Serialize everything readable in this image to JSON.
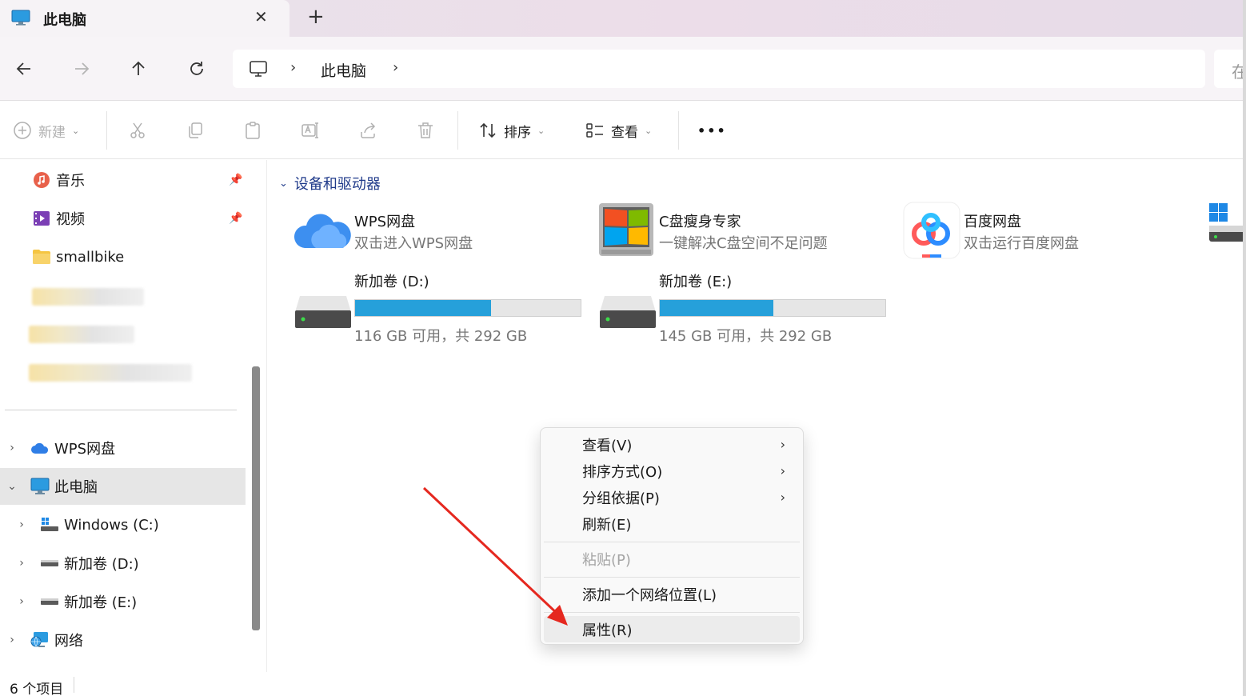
{
  "window": {
    "tab_title": "此电脑",
    "tab_close": "✕",
    "new_tab": "+"
  },
  "nav": {
    "address_segment": "此电脑",
    "sep": "›",
    "search_placeholder": "在"
  },
  "toolbar": {
    "new_label": "新建",
    "sort_label": "排序",
    "view_label": "查看",
    "more_label": "•••"
  },
  "sidebar": {
    "quick_items": [
      {
        "label": "音乐",
        "pinned": true
      },
      {
        "label": "视频",
        "pinned": true
      },
      {
        "label": "smallbike",
        "pinned": false
      }
    ],
    "tree": [
      {
        "label": "WPS网盘",
        "expanded": false
      },
      {
        "label": "此电脑",
        "expanded": true,
        "selected": true
      },
      {
        "label": "Windows (C:)",
        "expanded": false
      },
      {
        "label": "新加卷 (D:)",
        "expanded": false
      },
      {
        "label": "新加卷 (E:)",
        "expanded": false
      },
      {
        "label": "网络",
        "expanded": false
      }
    ]
  },
  "main": {
    "group_title": "设备和驱动器",
    "apps": [
      {
        "name": "WPS网盘",
        "sub": "双击进入WPS网盘"
      },
      {
        "name": "C盘瘦身专家",
        "sub": "一键解决C盘空间不足问题"
      },
      {
        "name": "百度网盘",
        "sub": "双击运行百度网盘"
      }
    ],
    "drives": [
      {
        "name": "新加卷 (D:)",
        "free_text": "116 GB 可用，共 292 GB",
        "used_fraction": 0.603
      },
      {
        "name": "新加卷 (E:)",
        "free_text": "145 GB 可用，共 292 GB",
        "used_fraction": 0.503
      }
    ]
  },
  "context_menu": {
    "items": [
      {
        "label": "查看(V)",
        "submenu": true,
        "disabled": false
      },
      {
        "label": "排序方式(O)",
        "submenu": true,
        "disabled": false
      },
      {
        "label": "分组依据(P)",
        "submenu": true,
        "disabled": false
      },
      {
        "label": "刷新(E)",
        "submenu": false,
        "disabled": false
      },
      {
        "label": "粘贴(P)",
        "submenu": false,
        "disabled": true
      },
      {
        "label": "添加一个网络位置(L)",
        "submenu": false,
        "disabled": false
      },
      {
        "label": "属性(R)",
        "submenu": false,
        "disabled": false,
        "hover": true
      }
    ]
  },
  "status": {
    "item_count": "6 个项目"
  },
  "colors": {
    "accent_blue": "#26a0da",
    "annotation_red": "#e5281f",
    "group_header": "#1f3a8a"
  }
}
